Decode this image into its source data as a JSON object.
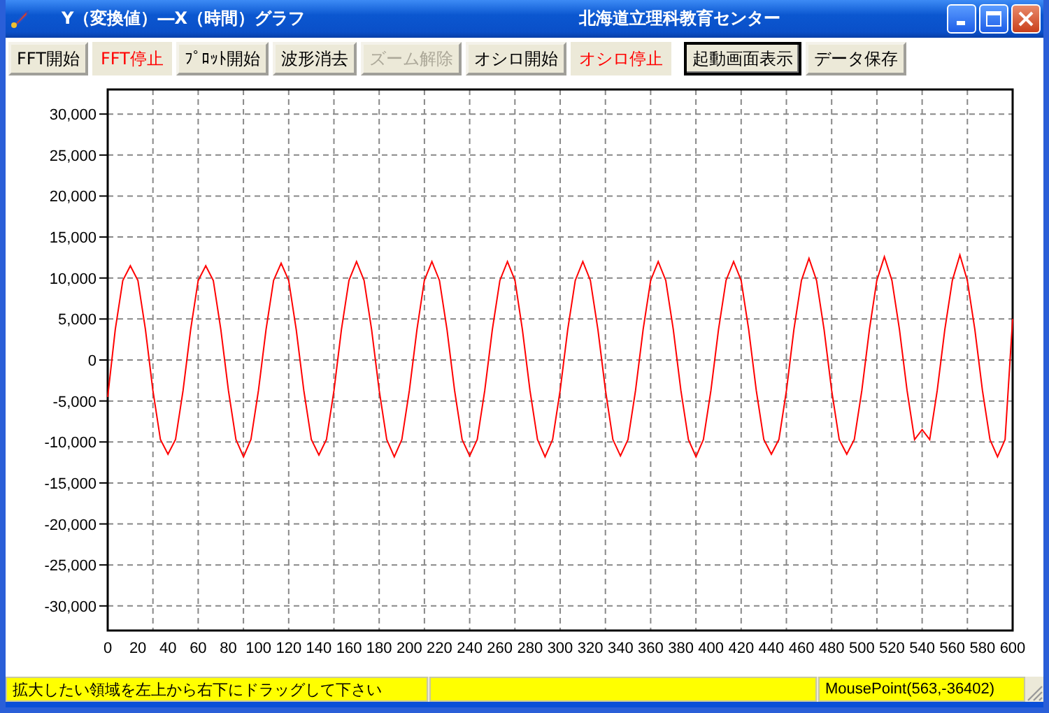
{
  "window": {
    "title": "Y（変換値）―X（時間）グラフ",
    "organization": "北海道立理科教育センター"
  },
  "toolbar": [
    {
      "label": "FFT開始",
      "disabled": false,
      "running": false,
      "default": false
    },
    {
      "label": "FFT停止",
      "disabled": false,
      "running": true,
      "default": false
    },
    {
      "label": "ﾌﾟﾛｯﾄ開始",
      "disabled": false,
      "running": false,
      "default": false
    },
    {
      "label": "波形消去",
      "disabled": false,
      "running": false,
      "default": false
    },
    {
      "label": "ズーム解除",
      "disabled": true,
      "running": false,
      "default": false
    },
    {
      "label": "オシロ開始",
      "disabled": false,
      "running": false,
      "default": false
    },
    {
      "label": "オシロ停止",
      "disabled": false,
      "running": true,
      "default": false
    },
    {
      "label": "起動画面表示",
      "disabled": false,
      "running": false,
      "default": true
    },
    {
      "label": "データ保存",
      "disabled": false,
      "running": false,
      "default": false
    }
  ],
  "chart": {
    "chart_data": {
      "type": "line",
      "xlim": [
        0,
        600
      ],
      "ylim": [
        -33000,
        33000
      ],
      "xticks": [
        0,
        20,
        40,
        60,
        80,
        100,
        120,
        140,
        160,
        180,
        200,
        220,
        240,
        260,
        280,
        300,
        320,
        340,
        360,
        380,
        400,
        420,
        440,
        460,
        480,
        500,
        520,
        540,
        560,
        580,
        600
      ],
      "yticks": [
        {
          "value": 30000,
          "label": "30,000"
        },
        {
          "value": 25000,
          "label": "25,000"
        },
        {
          "value": 20000,
          "label": "20,000"
        },
        {
          "value": 15000,
          "label": "15,000"
        },
        {
          "value": 10000,
          "label": "10,000"
        },
        {
          "value": 5000,
          "label": "5,000"
        },
        {
          "value": 0,
          "label": "0"
        },
        {
          "value": -5000,
          "label": "-5,000"
        },
        {
          "value": -10000,
          "label": "-10,000"
        },
        {
          "value": -15000,
          "label": "-15,000"
        },
        {
          "value": -20000,
          "label": "-20,000"
        },
        {
          "value": -25000,
          "label": "-25,000"
        },
        {
          "value": -30000,
          "label": "-30,000"
        }
      ],
      "x": [
        0,
        5,
        10,
        15,
        20,
        25,
        30,
        35,
        40,
        45,
        50,
        55,
        60,
        65,
        70,
        75,
        80,
        85,
        90,
        95,
        100,
        105,
        110,
        115,
        120,
        125,
        130,
        135,
        140,
        145,
        150,
        155,
        160,
        165,
        170,
        175,
        180,
        185,
        190,
        195,
        200,
        205,
        210,
        215,
        220,
        225,
        230,
        235,
        240,
        245,
        250,
        255,
        260,
        265,
        270,
        275,
        280,
        285,
        290,
        295,
        300,
        305,
        310,
        315,
        320,
        325,
        330,
        335,
        340,
        345,
        350,
        355,
        360,
        365,
        370,
        375,
        380,
        385,
        390,
        395,
        400,
        405,
        410,
        415,
        420,
        425,
        430,
        435,
        440,
        445,
        450,
        455,
        460,
        465,
        470,
        475,
        480,
        485,
        490,
        495,
        500,
        505,
        510,
        515,
        520,
        525,
        530,
        535,
        540,
        545,
        550,
        555,
        560,
        565,
        570,
        575,
        580,
        585,
        590,
        595,
        600
      ],
      "grid": true,
      "series": [
        {
          "color": "#ff0000",
          "values": [
            -4500,
            3700,
            9700,
            11500,
            9700,
            3700,
            -3700,
            -9700,
            -11500,
            -9700,
            -3700,
            3700,
            9700,
            11500,
            9700,
            3700,
            -3700,
            -9700,
            -11800,
            -9700,
            -3700,
            3700,
            9700,
            11800,
            9700,
            3700,
            -3700,
            -9700,
            -11600,
            -9700,
            -3700,
            3700,
            9700,
            12000,
            9700,
            3700,
            -3700,
            -9700,
            -11800,
            -9700,
            -3700,
            3700,
            9700,
            12000,
            9700,
            3700,
            -3700,
            -9700,
            -11700,
            -9700,
            -3700,
            3700,
            9700,
            12000,
            9700,
            3700,
            -3700,
            -9700,
            -11800,
            -9700,
            -3700,
            3700,
            9700,
            12000,
            9700,
            3700,
            -3700,
            -9700,
            -11700,
            -9700,
            -3700,
            3700,
            9700,
            12000,
            9700,
            3700,
            -3700,
            -9700,
            -11800,
            -9700,
            -3700,
            3700,
            9700,
            12000,
            9700,
            3700,
            -3700,
            -9700,
            -11500,
            -9700,
            -3700,
            3700,
            9700,
            12400,
            9700,
            3700,
            -3700,
            -9700,
            -11500,
            -9700,
            -3700,
            3700,
            9700,
            12600,
            9700,
            3700,
            -3700,
            -9700,
            -8500,
            -9700,
            -3700,
            3700,
            9700,
            12800,
            9700,
            3700,
            -3700,
            -9700,
            -11800,
            -9700,
            5000
          ]
        }
      ]
    }
  },
  "status_bar": {
    "hint": "拡大したい領域を左上から右下にドラッグして下さい",
    "mouse_point": "MousePoint(563,-36402)"
  }
}
